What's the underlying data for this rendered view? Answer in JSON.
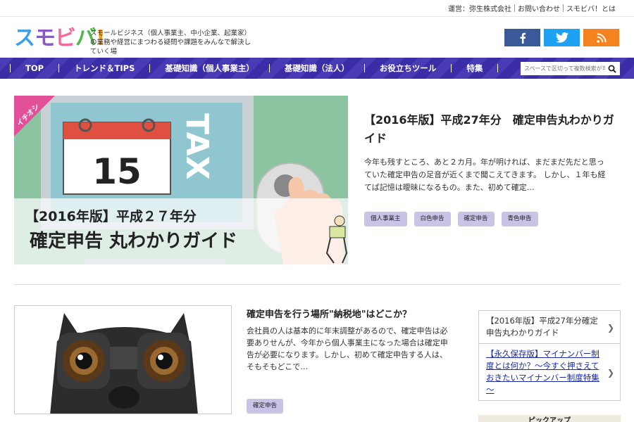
{
  "utility": {
    "operator": "運営：弥生株式会社",
    "contact": "お問い合わせ",
    "about": "スモビバ！とは"
  },
  "header": {
    "logo": [
      "ス",
      "モ",
      "ビ",
      "バ",
      "!"
    ],
    "tagline": "スモールビジネス（個人事業主、中小企業、起業家）の業務や経営にまつわる疑問や課題をみんなで解決していく場",
    "social": {
      "facebook": "f",
      "twitter": "t",
      "rss": "rss"
    }
  },
  "nav": {
    "items": [
      "TOP",
      "トレンド＆TIPS",
      "基礎知識（個人事業主）",
      "基礎知識（法人）",
      "お役立ちツール",
      "特集"
    ],
    "search_placeholder": "スペースで区切って複数検索が可能"
  },
  "featured": {
    "badge": "イチオシ",
    "calendar_day": "15",
    "tax": "TAX",
    "banner_line1": "【2016年版】平成２７年分",
    "banner_line2": "確定申告 丸わかりガイド",
    "title": "【2016年版】平成27年分　確定申告丸わかりガイド",
    "excerpt": "今年も残すところ、あと２カ月。年が明ければ、まだまだ先だと思っていた確定申告の足音が近くまで聞こえてきます。 しかし、１年も経てば記憶は曖昧になるもの。また、初めて確定…",
    "tags": [
      "個人事業主",
      "白色申告",
      "確定申告",
      "青色申告"
    ]
  },
  "article2": {
    "title": "確定申告を行う場所\"納税地\"はどこか？",
    "excerpt": "会社員の人は基本的に年末調整があるので、確定申告は必要ありせんが、今年から個人事業主になった場合は確定申告が必要になります。しかし、初めて確定申告する人は、そもそもどこで…",
    "tags": [
      "確定申告"
    ]
  },
  "sidebar": {
    "items": [
      {
        "label": "【2016年版】平成27年分確定申告丸わかりガイド"
      },
      {
        "label": "【永久保存版】マイナンバー制度とは何か？～今すぐ押さえておきたいマイナンバー制度特集～"
      }
    ],
    "pickup": "ピックアップ"
  },
  "colors": {
    "nav": "#3e2fb0",
    "tag": "#c8c4e8",
    "badge": "#e2509a",
    "feature_bg": "#8cc3a0"
  }
}
